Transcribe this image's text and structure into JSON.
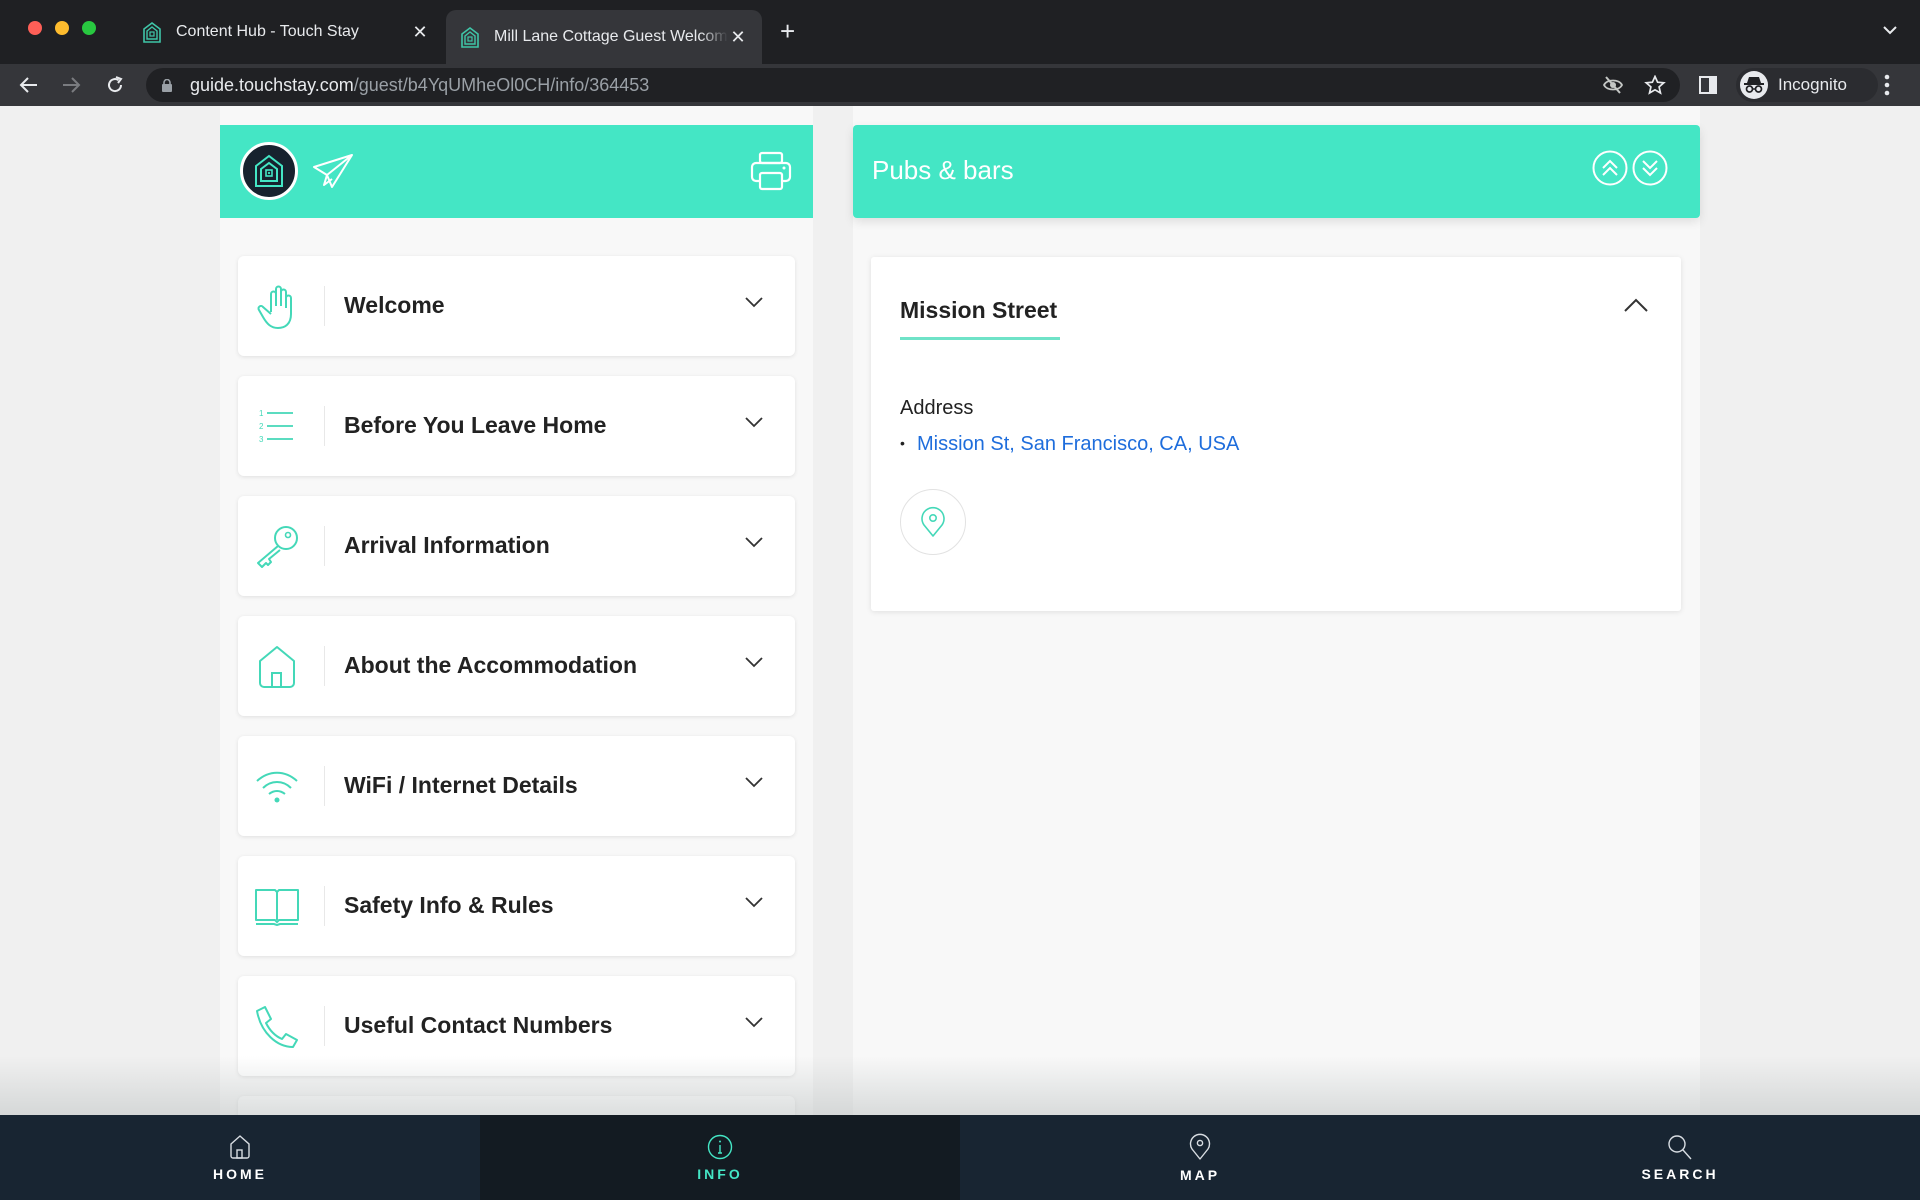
{
  "browser": {
    "tabs": [
      {
        "title": "Content Hub - Touch Stay",
        "active": false,
        "favicon": "touchstay-house-icon"
      },
      {
        "title": "Mill Lane Cottage Guest Welcome",
        "active": true,
        "favicon": "touchstay-house-icon"
      }
    ],
    "url_host": "guide.touchstay.com",
    "url_path": "/guest/b4YqUMheOl0CH/info/364453",
    "profile_label": "Incognito"
  },
  "left_panel": {
    "header_color": "#44e6c5",
    "menu_items": [
      {
        "label": "Welcome",
        "icon": "hand-wave-icon"
      },
      {
        "label": "Before You Leave Home",
        "icon": "numbered-list-icon"
      },
      {
        "label": "Arrival Information",
        "icon": "key-icon"
      },
      {
        "label": "About the Accommodation",
        "icon": "house-icon"
      },
      {
        "label": "WiFi / Internet Details",
        "icon": "wifi-icon"
      },
      {
        "label": "Safety Info & Rules",
        "icon": "book-icon"
      },
      {
        "label": "Useful Contact Numbers",
        "icon": "phone-icon"
      }
    ]
  },
  "right_panel": {
    "title": "Pubs & bars",
    "card": {
      "title": "Mission Street",
      "address_label": "Address",
      "address_bullet": "•",
      "address_link": "Mission St, San Francisco, CA, USA"
    }
  },
  "bottom_nav": {
    "items": [
      {
        "label": "HOME",
        "icon": "home-icon",
        "active": false
      },
      {
        "label": "INFO",
        "icon": "info-icon",
        "active": true
      },
      {
        "label": "MAP",
        "icon": "map-pin-icon",
        "active": false
      },
      {
        "label": "SEARCH",
        "icon": "search-icon",
        "active": false
      }
    ]
  },
  "colors": {
    "accent": "#44e6c5",
    "nav_bg": "#182532",
    "link": "#1e6ddc"
  }
}
